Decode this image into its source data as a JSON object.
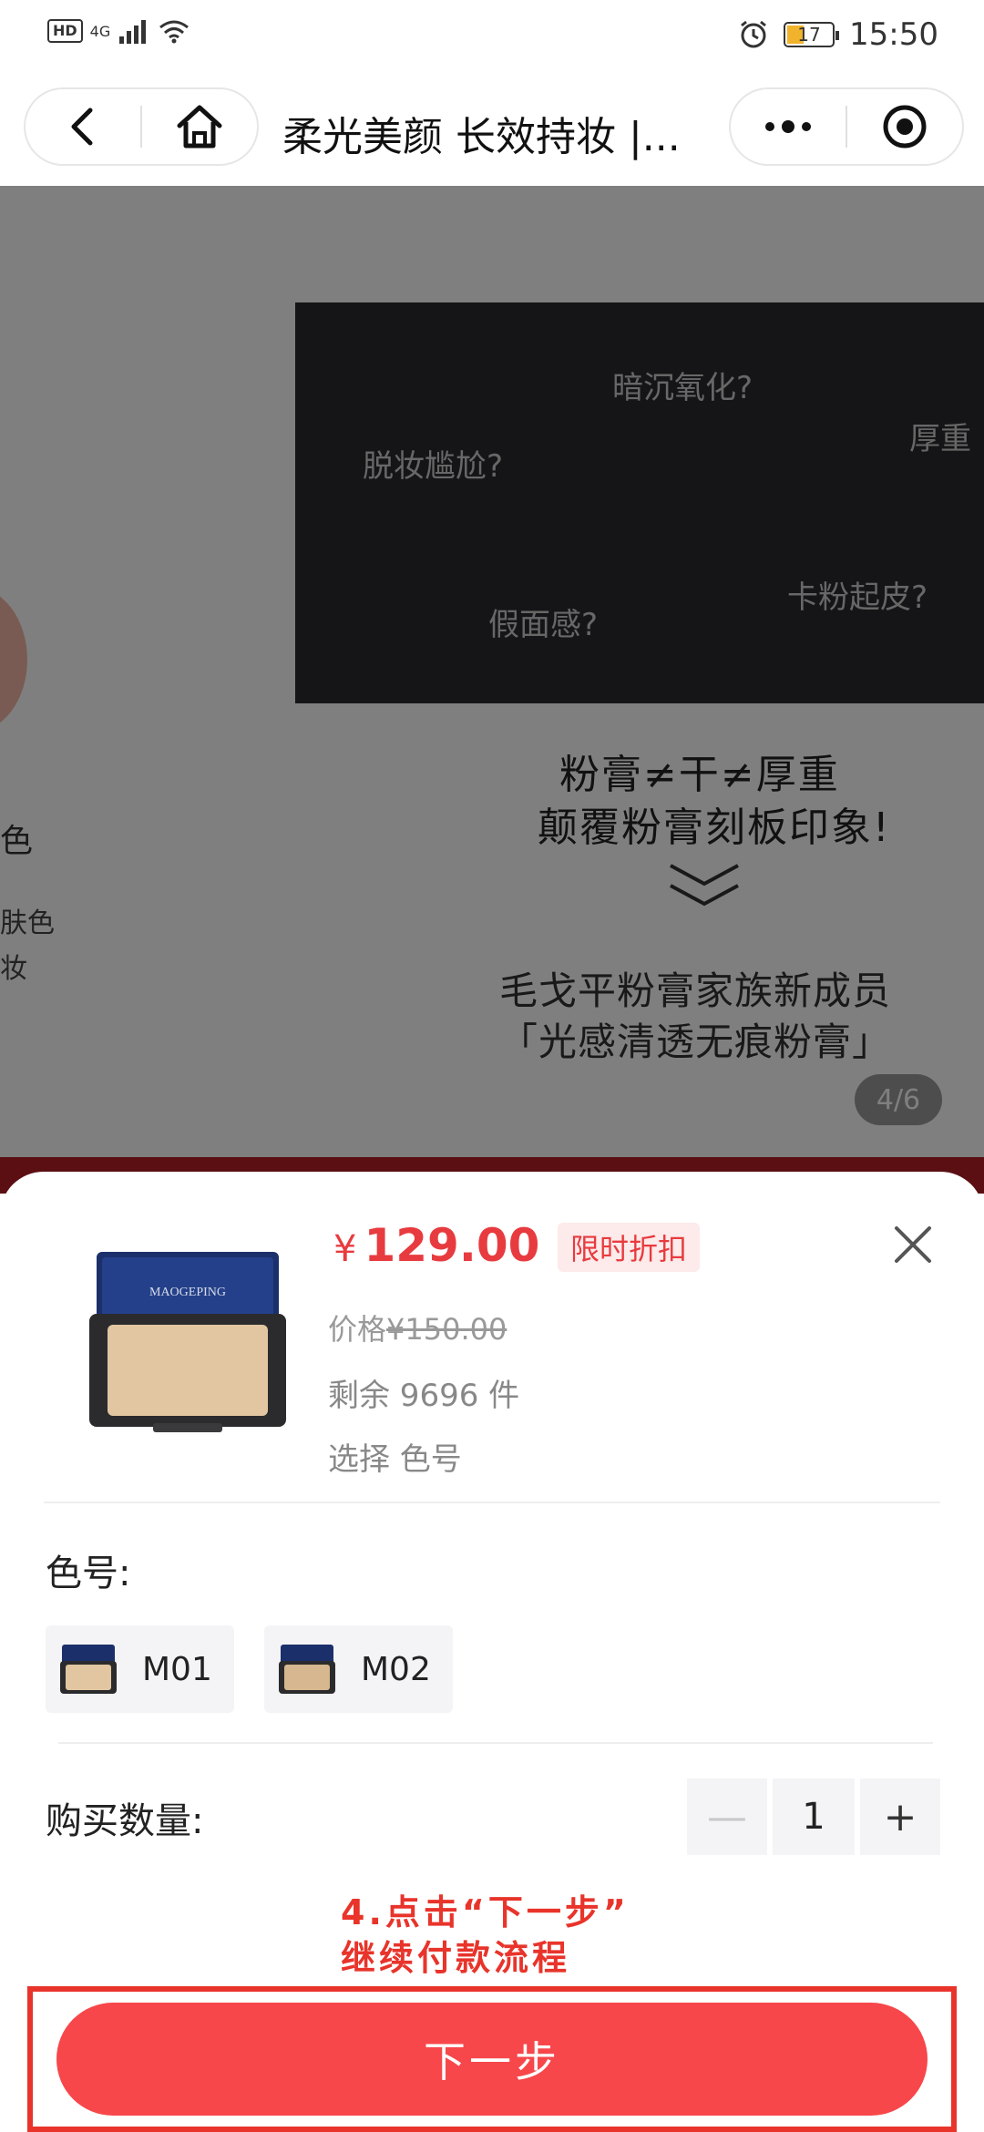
{
  "status_bar": {
    "network_badge": "HD",
    "network_type": "4G",
    "time": "15:50",
    "battery_level": "17",
    "battery_color": "#f0b32b"
  },
  "nav": {
    "back_icon": "chevron-left-icon",
    "home_icon": "home-icon",
    "title": "柔光美颜 长效持妆 |...",
    "more_icon": "more-dots-icon",
    "target_icon": "target-circle-icon"
  },
  "background": {
    "peek_title": "色",
    "peek_line1": "肤色",
    "peek_line2": "妆",
    "questions": [
      "暗沉氧化?",
      "脱妆尴尬?",
      "厚重",
      "假面感?",
      "卡粉起皮?"
    ],
    "slogan_line1": "粉膏≠干≠厚重",
    "slogan_line2": "颠覆粉膏刻板印象!",
    "family_line1": "毛戈平粉膏家族新成员",
    "family_line2": "「光感清透无痕粉膏」",
    "page_indicator": "4/6"
  },
  "sheet": {
    "price_symbol": "¥",
    "price": "129.00",
    "sale_badge": "限时折扣",
    "original_price_label": "价格",
    "original_price": "¥150.00",
    "stock_text": "剩余 9696 件",
    "select_hint": "选择 色号",
    "color_label": "色号:",
    "color_options": [
      "M01",
      "M02"
    ],
    "quantity_label": "购买数量:",
    "quantity_value": "1",
    "minus_label": "—",
    "plus_label": "+",
    "annotation_line1": "4.点击“下一步”",
    "annotation_line2": "继续付款流程",
    "next_button": "下一步",
    "accent_color": "#f7474a",
    "annotation_color": "#e8342b"
  }
}
